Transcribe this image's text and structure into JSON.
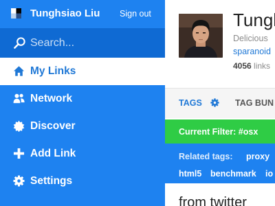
{
  "sidebar": {
    "user_name": "Tunghsiao Liu",
    "sign_out": "Sign out",
    "search": {
      "placeholder": "Search..."
    },
    "items": [
      {
        "label": "My Links",
        "icon": "home-icon"
      },
      {
        "label": "Network",
        "icon": "people-icon"
      },
      {
        "label": "Discover",
        "icon": "badge-icon"
      },
      {
        "label": "Add Link",
        "icon": "plus-icon"
      },
      {
        "label": "Settings",
        "icon": "gear-icon"
      }
    ],
    "active_item": "My Links"
  },
  "profile": {
    "name": "Tungh",
    "tagline": "Delicious",
    "link": "sparanoid",
    "link_count": "4056",
    "link_count_label": "links"
  },
  "tabs": {
    "tags": "TAGS",
    "tag_bundles": "TAG BUN"
  },
  "filter": {
    "label": "Current Filter: #osx"
  },
  "related": {
    "label": "Related tags:",
    "tags": [
      "proxy",
      "html5",
      "benchmark",
      "io"
    ]
  },
  "post": {
    "title": "from twitter"
  },
  "colors": {
    "brand_blue": "#1e82f0",
    "search_blue": "#0f6ad3",
    "active_text": "#1f78d6",
    "filter_green": "#2fcc45"
  }
}
